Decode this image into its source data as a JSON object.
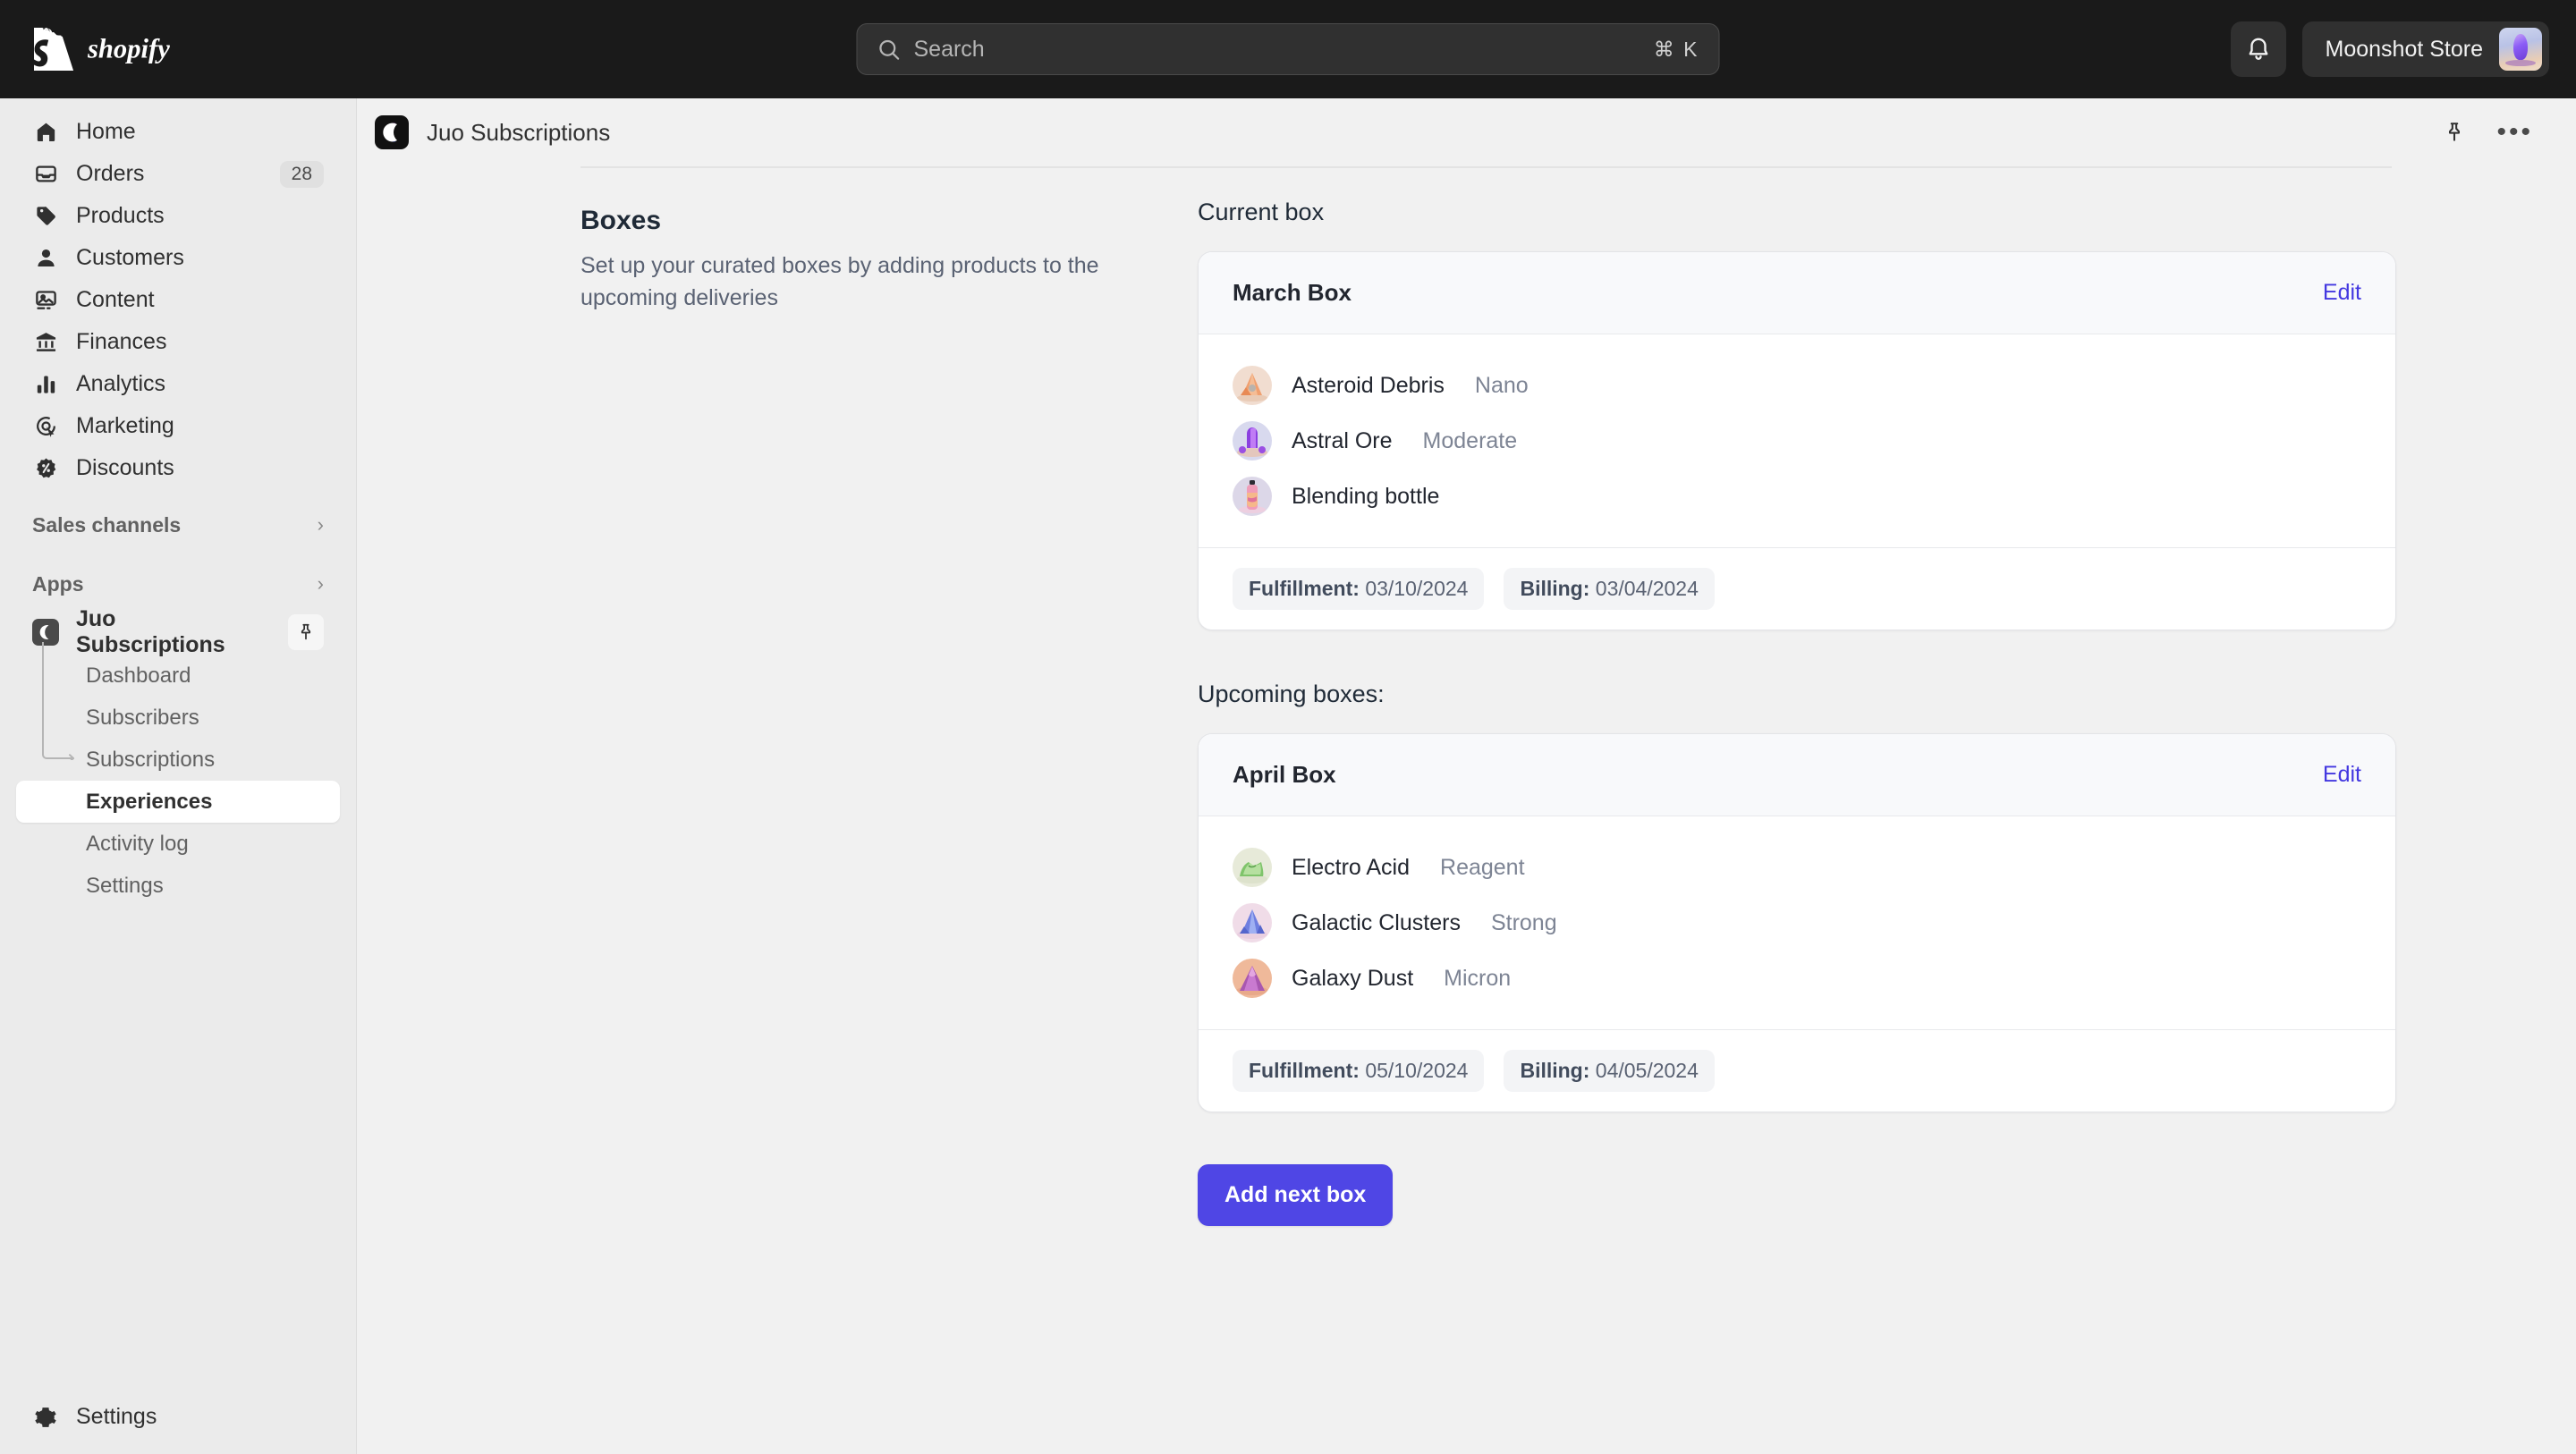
{
  "topbar": {
    "brand": "shopify",
    "search": {
      "placeholder": "Search",
      "shortcut": "⌘ K"
    },
    "notifications_icon": "bell-icon",
    "store_name": "Moonshot Store"
  },
  "sidebar": {
    "items": [
      {
        "label": "Home",
        "icon": "home-icon",
        "badge": ""
      },
      {
        "label": "Orders",
        "icon": "orders-inbox-icon",
        "badge": "28"
      },
      {
        "label": "Products",
        "icon": "tag-icon",
        "badge": ""
      },
      {
        "label": "Customers",
        "icon": "person-icon",
        "badge": ""
      },
      {
        "label": "Content",
        "icon": "image-icon",
        "badge": ""
      },
      {
        "label": "Finances",
        "icon": "bank-icon",
        "badge": ""
      },
      {
        "label": "Analytics",
        "icon": "bar-chart-icon",
        "badge": ""
      },
      {
        "label": "Marketing",
        "icon": "target-cursor-icon",
        "badge": ""
      },
      {
        "label": "Discounts",
        "icon": "discount-badge-icon",
        "badge": ""
      }
    ],
    "sales_channels": {
      "label": "Sales channels",
      "chevron": "›"
    },
    "apps": {
      "label": "Apps",
      "chevron": "›"
    },
    "app": {
      "name": "Juo Subscriptions",
      "icon": "juo-moon-icon",
      "pin_icon": "pin-icon",
      "subitems": [
        {
          "label": "Dashboard",
          "active": false
        },
        {
          "label": "Subscribers",
          "active": false
        },
        {
          "label": "Subscriptions",
          "active": false
        },
        {
          "label": "Experiences",
          "active": true
        },
        {
          "label": "Activity log",
          "active": false
        },
        {
          "label": "Settings",
          "active": false
        }
      ]
    },
    "footer": {
      "label": "Settings",
      "icon": "gear-icon"
    }
  },
  "app_header": {
    "title": "Juo Subscriptions",
    "icon": "juo-moon-icon",
    "pin_icon": "pin-icon",
    "more_icon": "ellipsis-icon",
    "more_label": "•••"
  },
  "main": {
    "section": {
      "title": "Boxes",
      "description": "Set up your curated boxes by adding products to the upcoming deliveries"
    },
    "current_box_label": "Current box",
    "upcoming_boxes_label": "Upcoming boxes:",
    "edit_label": "Edit",
    "add_button_label": "Add next box",
    "boxes": [
      {
        "title": "March Box",
        "products": [
          {
            "name": "Asteroid Debris",
            "variant": "Nano",
            "thumb": "orange-crystal"
          },
          {
            "name": "Astral Ore",
            "variant": "Moderate",
            "thumb": "purple-crystal"
          },
          {
            "name": "Blending bottle",
            "variant": "",
            "thumb": "bottle"
          }
        ],
        "fulfillment_label": "Fulfillment:",
        "fulfillment_date": "03/10/2024",
        "billing_label": "Billing:",
        "billing_date": "03/04/2024"
      },
      {
        "title": "April Box",
        "products": [
          {
            "name": "Electro Acid",
            "variant": "Reagent",
            "thumb": "green-crystal"
          },
          {
            "name": "Galactic Clusters",
            "variant": "Strong",
            "thumb": "blue-crystal"
          },
          {
            "name": "Galaxy Dust",
            "variant": "Micron",
            "thumb": "pink-mound"
          }
        ],
        "fulfillment_label": "Fulfillment:",
        "fulfillment_date": "05/10/2024",
        "billing_label": "Billing:",
        "billing_date": "04/05/2024"
      }
    ]
  },
  "colors": {
    "topbar_bg": "#1A1A1A",
    "sidebar_bg": "#EBEBEB",
    "main_bg": "#F1F1F1",
    "accent": "#4F46E5",
    "link": "#4338E0"
  }
}
